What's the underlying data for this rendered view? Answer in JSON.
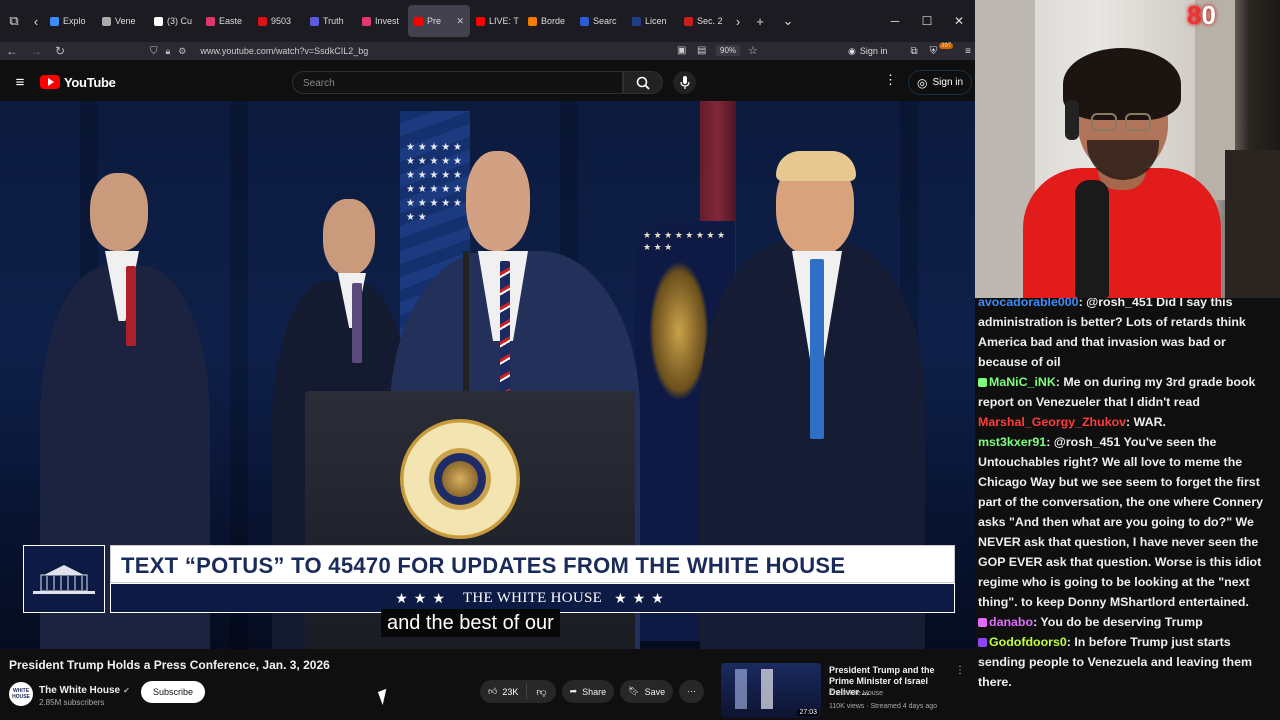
{
  "browser": {
    "tabs": [
      {
        "label": "Explo",
        "color": "#3d8bff"
      },
      {
        "label": "Vene",
        "color": "#aaaaaa"
      },
      {
        "label": "(3) Cu",
        "color": "#ffffff"
      },
      {
        "label": "Easte",
        "color": "#e2366e"
      },
      {
        "label": "9503",
        "color": "#d11"
      },
      {
        "label": "Truth",
        "color": "#5d5be0"
      },
      {
        "label": "Invest",
        "color": "#e2366e"
      },
      {
        "label": "Pre",
        "color": "#ff0000",
        "active": true
      },
      {
        "label": "LIVE: T",
        "color": "#ff0000"
      },
      {
        "label": "Borde",
        "color": "#f57c00"
      },
      {
        "label": "Searc",
        "color": "#2c5bd4"
      },
      {
        "label": "Licen",
        "color": "#1f3e8a"
      },
      {
        "label": "Sec. 2",
        "color": "#c81e1e"
      }
    ],
    "url": "www.youtube.com/watch?v=SsdkCIL2_bg",
    "zoom": "90%",
    "sign_in": "Sign in",
    "ext_badge": "397"
  },
  "youtube": {
    "logo_text": "YouTube",
    "search_placeholder": "Search",
    "sign_in": "Sign in"
  },
  "video": {
    "lower_third_text": "TEXT “POTUS” TO 45470 FOR UPDATES FROM THE WHITE HOUSE",
    "lower_third_stars": "★★★",
    "lower_third_brand": "THE WHITE HOUSE",
    "caption": "and the best of our",
    "seal_text": "SEAL OF THE PRESIDENT OF THE UNITED STATES",
    "title": "President Trump Holds a Press Conference, Jan. 3, 2026"
  },
  "channel": {
    "name": "The White House",
    "subscribers": "2.85M subscribers",
    "subscribe_label": "Subscribe",
    "avatar_text": "WHITE HOUSE"
  },
  "actions": {
    "likes": "23K",
    "share": "Share",
    "save": "Save"
  },
  "recommendation": {
    "title": "President Trump and the Prime Minister of Israel Deliver ...",
    "channel": "The White House",
    "meta": "110K views · Streamed 4 days ago",
    "duration": "27:03"
  },
  "webcam": {
    "counter": "0"
  },
  "chat": {
    "messages": [
      {
        "user": "avocadorable000",
        "color": "#3d8bff",
        "text": ": @rosh_451 Did I say this administration is better? Lots of retards think America bad and that invasion was bad or because of oil"
      },
      {
        "user": "MaNiC_iNK",
        "color": "#7cff7c",
        "text": ": Me on during my 3rd grade book report on Venezueler that I didn't read",
        "badge": "#7cff7c"
      },
      {
        "user": "Marshal_Georgy_Zhukov",
        "color": "#ff3b3b",
        "text": ": WAR."
      },
      {
        "user": "mst3kxer91",
        "color": "#7cff7c",
        "text": ": @rosh_451 You've seen the Untouchables right? We all love to meme the Chicago Way but we see seem to forget the first part of the conversation, the one where Connery asks \"And then what are you going to do?\" We NEVER ask that question, I have never seen the GOP EVER ask that question. Worse is this idiot regime who is going to be looking at the \"next thing\". to keep Donny MShartlord entertained."
      },
      {
        "user": "danabo",
        "color": "#e36bff",
        "text": ": You do be deserving Trump",
        "badge": "#e36bff"
      },
      {
        "user": "Godofdoors0",
        "color": "#c0ff3a",
        "text": ": In before Trump just starts sending people to Venezuela and leaving them there.",
        "badge": "#8e44ff"
      }
    ]
  }
}
